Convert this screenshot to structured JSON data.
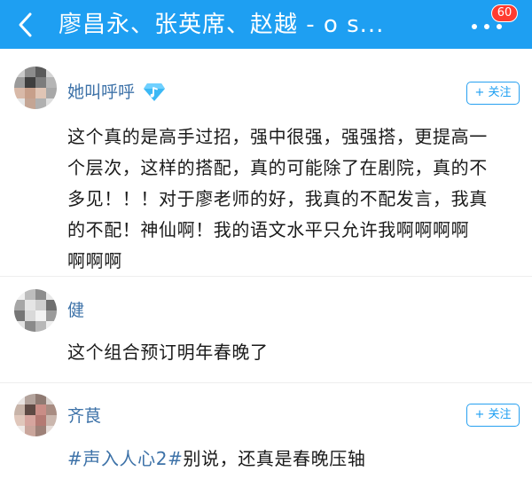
{
  "header": {
    "title": "廖昌永、张英席、赵越 - o s...",
    "back_icon": "chevron-left-icon",
    "more_icon": "more-dots-icon",
    "badge": "60",
    "background": "#1e9ff2"
  },
  "comments": [
    {
      "username": "她叫呼呼",
      "badge_icon": "music-diamond-icon",
      "follow_label": "+ 关注",
      "text_lines": [
        "这个真的是高手过招，强中很强，强强搭，更提高一",
        "个层次，这样的搭配，真的可能除了在剧院，真的不",
        "多见！！！对于廖老师的好，我真的不配发言，我真",
        "的不配！神仙啊！我的语文水平只允许我啊啊啊啊",
        "啊啊啊"
      ]
    },
    {
      "username": "健",
      "text_lines": [
        "这个组合预订明年春晚了"
      ]
    },
    {
      "username": "齐茛",
      "follow_label": "+ 关注",
      "hashtag": "#声入人心2#",
      "text_rest": "别说，还真是春晚压轴"
    }
  ],
  "colors": {
    "accent": "#1e9ff2",
    "username": "#3d72a8",
    "badge": "#ff3b30"
  }
}
